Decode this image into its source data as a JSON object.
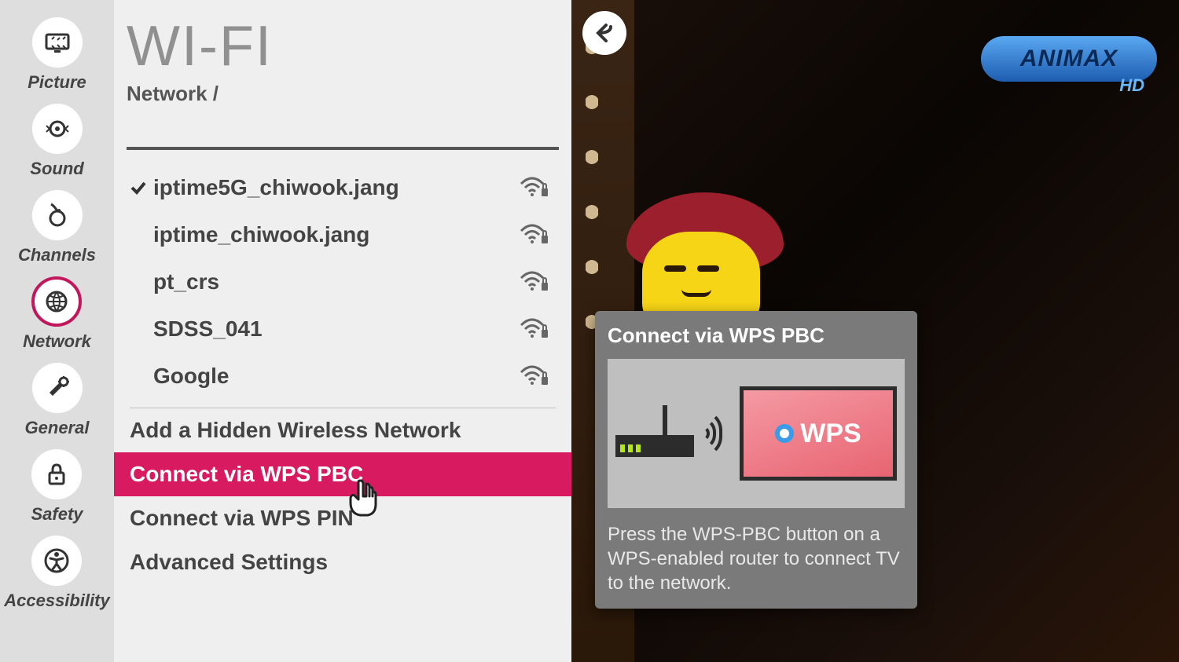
{
  "sidebar": {
    "items": [
      {
        "label": "Picture",
        "icon": "picture"
      },
      {
        "label": "Sound",
        "icon": "sound"
      },
      {
        "label": "Channels",
        "icon": "channels"
      },
      {
        "label": "Network",
        "icon": "network"
      },
      {
        "label": "General",
        "icon": "general"
      },
      {
        "label": "Safety",
        "icon": "safety"
      },
      {
        "label": "Accessibility",
        "icon": "accessibility"
      }
    ],
    "active_index": 3
  },
  "header": {
    "title": "WI-FI",
    "breadcrumb": "Network /"
  },
  "networks": [
    {
      "name": "iptime5G_chiwook.jang",
      "connected": true,
      "secured": true
    },
    {
      "name": "iptime_chiwook.jang",
      "connected": false,
      "secured": true
    },
    {
      "name": "pt_crs",
      "connected": false,
      "secured": true
    },
    {
      "name": "SDSS_041",
      "connected": false,
      "secured": true
    },
    {
      "name": "Google",
      "connected": false,
      "secured": true
    }
  ],
  "options": {
    "add_hidden": "Add a Hidden Wireless Network",
    "wps_pbc": "Connect via WPS PBC",
    "wps_pin": "Connect via WPS PIN",
    "advanced": "Advanced Settings",
    "selected": "wps_pbc"
  },
  "info_panel": {
    "title": "Connect via WPS PBC",
    "wps_label": "WPS",
    "description": "Press the WPS-PBC button on a WPS-enabled router to connect TV to the network."
  },
  "tv": {
    "channel_logo": "ANIMAX",
    "channel_quality": "HD"
  }
}
